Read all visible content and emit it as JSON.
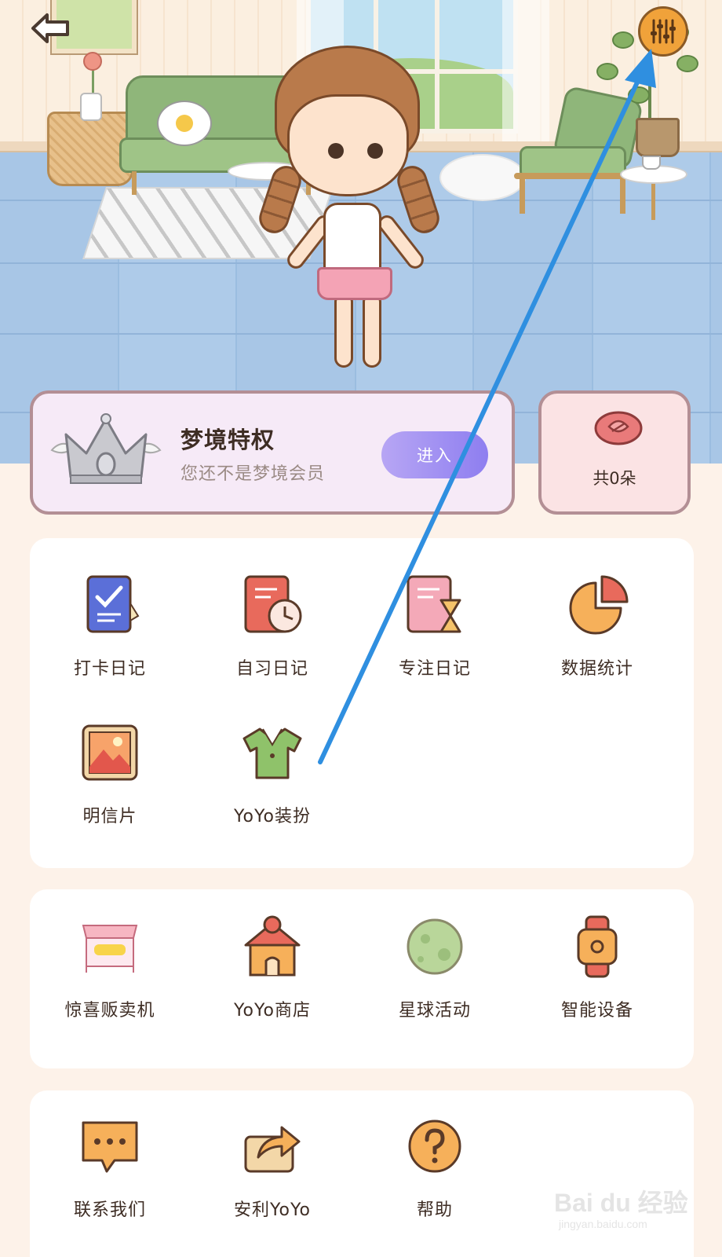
{
  "scene": {
    "description_icon": "room-scene"
  },
  "top_bar": {
    "back_icon": "back-arrow-icon",
    "settings_icon": "sliders-settings-icon"
  },
  "vip": {
    "title": "梦境特权",
    "subtitle": "您还不是梦境会员",
    "enter_label": "进入",
    "crown_icon": "silver-crown-icon"
  },
  "flowers": {
    "count_label": "共0朵",
    "icon": "rose-icon"
  },
  "diary_grid": {
    "items": [
      {
        "label": "打卡日记",
        "icon": "checkin-diary-icon"
      },
      {
        "label": "自习日记",
        "icon": "study-diary-icon"
      },
      {
        "label": "专注日记",
        "icon": "focus-diary-icon"
      },
      {
        "label": "数据统计",
        "icon": "pie-chart-icon"
      },
      {
        "label": "明信片",
        "icon": "postcard-icon"
      },
      {
        "label": "YoYo装扮",
        "icon": "outfit-icon"
      }
    ]
  },
  "shop_grid": {
    "items": [
      {
        "label": "惊喜贩卖机",
        "icon": "vending-machine-icon"
      },
      {
        "label": "YoYo商店",
        "icon": "shop-icon"
      },
      {
        "label": "星球活动",
        "icon": "planet-icon"
      },
      {
        "label": "智能设备",
        "icon": "smartwatch-icon"
      }
    ]
  },
  "misc_grid": {
    "items": [
      {
        "label": "联系我们",
        "icon": "chat-bubble-icon"
      },
      {
        "label": "安利YoYo",
        "icon": "share-icon"
      },
      {
        "label": "帮助",
        "icon": "help-icon"
      }
    ]
  },
  "watermark": {
    "logo": "Bai du 经验",
    "url": "jingyan.baidu.com"
  },
  "colors": {
    "accent_orange": "#f0a23a",
    "enter_button": "#8e7ef0",
    "arrow": "#2f8fe0",
    "page_bg": "#fdf2e9"
  }
}
